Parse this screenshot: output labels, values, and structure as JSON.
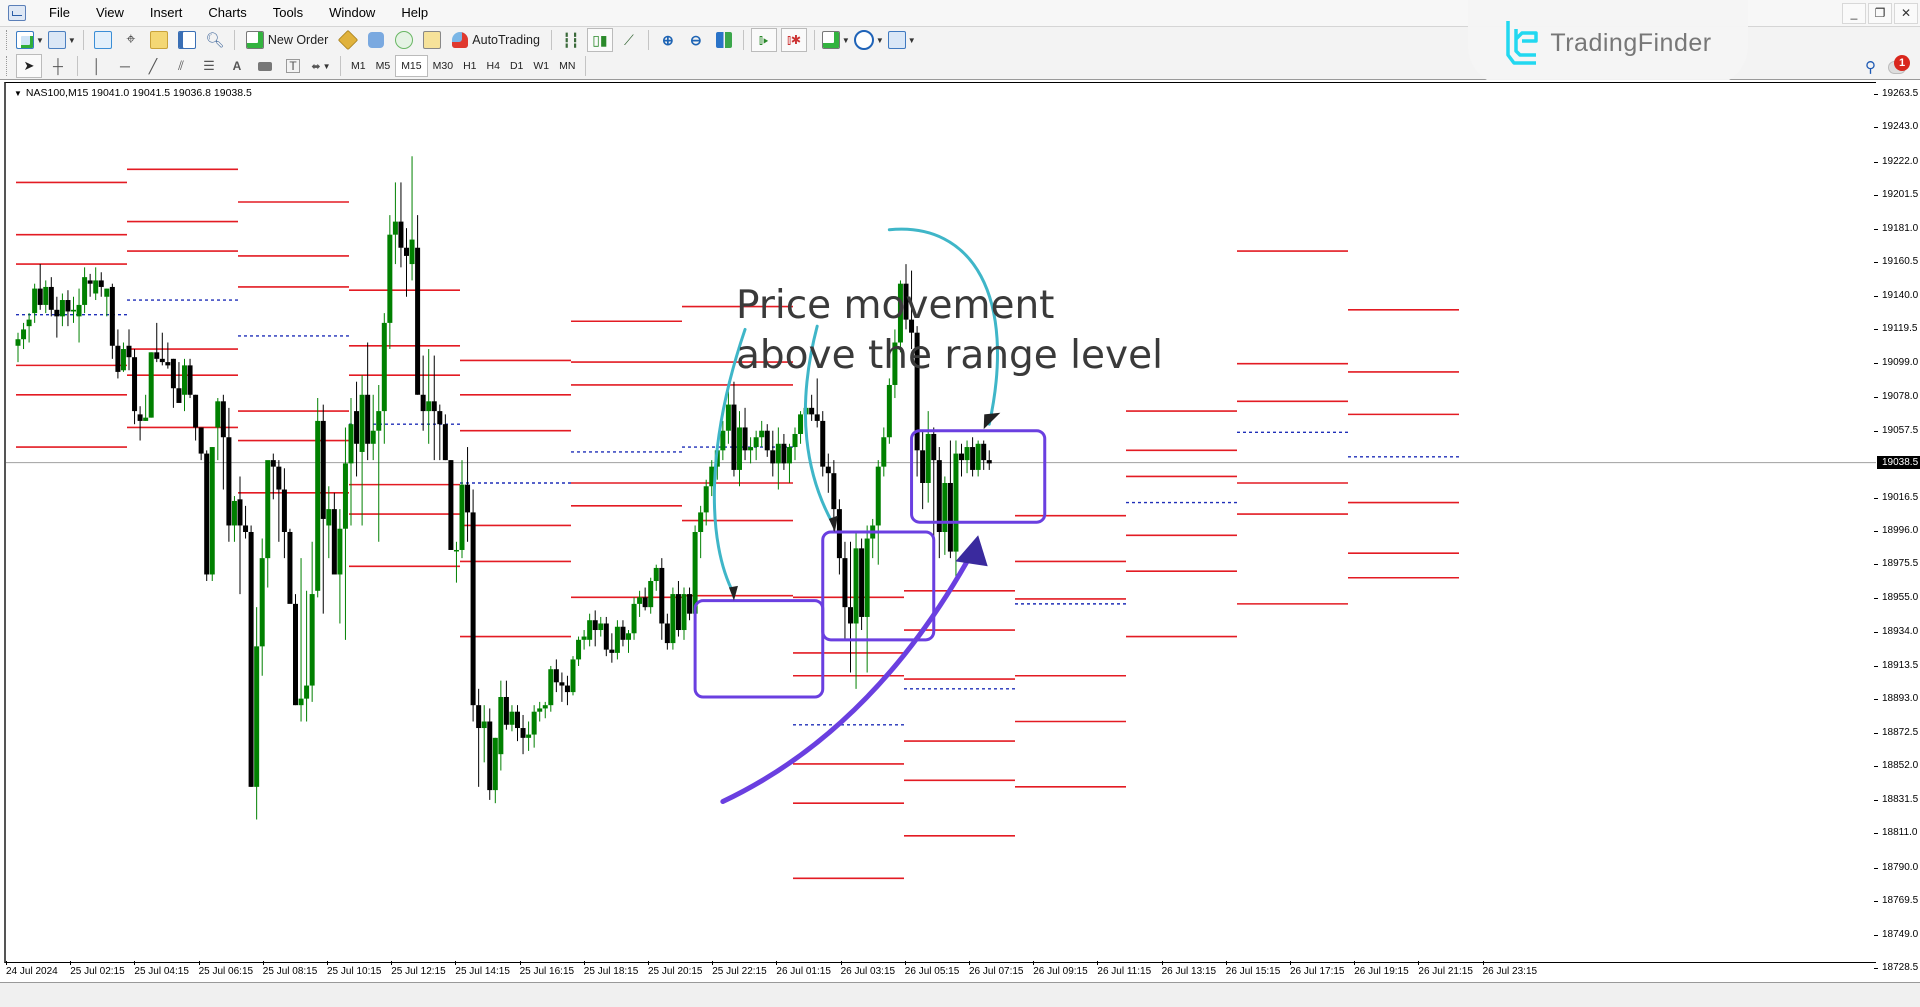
{
  "menubar": {
    "items": [
      "File",
      "View",
      "Insert",
      "Charts",
      "Tools",
      "Window",
      "Help"
    ]
  },
  "window_controls": {
    "minimize": "_",
    "restore": "❐",
    "close": "✕"
  },
  "toolbar": {
    "new_order_label": "New Order",
    "autotrading_label": "AutoTrading",
    "timeframes": [
      "M1",
      "M5",
      "M15",
      "M30",
      "H1",
      "H4",
      "D1",
      "W1",
      "MN"
    ],
    "active_timeframe": "M15",
    "drawing_tools": [
      "cursor",
      "crosshair",
      "vertical-line",
      "horizontal-line",
      "trendline",
      "equidistant-channel",
      "fibonacci",
      "text",
      "label",
      "text-label",
      "arrows"
    ]
  },
  "notifications": {
    "count": "1"
  },
  "brand": {
    "name": "TradingFinder"
  },
  "chart": {
    "symbol_header": "NAS100,M15  19041.0 19041.5 19036.8 19038.5",
    "current_price": "19038.5",
    "annotation": {
      "line1": "Price movement",
      "line2": "above the range level"
    }
  },
  "chart_data": {
    "type": "candlestick",
    "title": "NAS100,M15",
    "ohlc_header": {
      "open": 19041.0,
      "high": 19041.5,
      "low": 19036.8,
      "close": 19038.5
    },
    "ylim": [
      18728.5,
      19263.5
    ],
    "y_ticks": [
      "19263.5",
      "19243.0",
      "19222.0",
      "19201.5",
      "19181.0",
      "19160.5",
      "19140.0",
      "19119.5",
      "19099.0",
      "19078.0",
      "19057.5",
      "19038.5",
      "19016.5",
      "18996.0",
      "18975.5",
      "18955.0",
      "18934.0",
      "18913.5",
      "18893.0",
      "18872.5",
      "18852.0",
      "18831.5",
      "18811.0",
      "18790.0",
      "18769.5",
      "18749.0",
      "18728.5"
    ],
    "x_ticks": [
      "24 Jul 2024",
      "25 Jul 02:15",
      "25 Jul 04:15",
      "25 Jul 06:15",
      "25 Jul 08:15",
      "25 Jul 10:15",
      "25 Jul 12:15",
      "25 Jul 14:15",
      "25 Jul 16:15",
      "25 Jul 18:15",
      "25 Jul 20:15",
      "25 Jul 22:15",
      "26 Jul 01:15",
      "26 Jul 03:15",
      "26 Jul 05:15",
      "26 Jul 07:15",
      "26 Jul 09:15",
      "26 Jul 11:15",
      "26 Jul 13:15",
      "26 Jul 15:15",
      "26 Jul 17:15",
      "26 Jul 19:15",
      "26 Jul 21:15",
      "26 Jul 23:15"
    ],
    "bull_color": "#008000",
    "bear_color": "#000000",
    "level_color": "#e31b23",
    "mid_level_color": "#1f2fb8",
    "current_price_line": 19038.5,
    "candles": [
      [
        19110,
        19118,
        19100,
        19114
      ],
      [
        19114,
        19124,
        19108,
        19120
      ],
      [
        19122,
        19130,
        19112,
        19126
      ],
      [
        19130,
        19148,
        19124,
        19145
      ],
      [
        19145,
        19160,
        19132,
        19135
      ],
      [
        19135,
        19150,
        19130,
        19146
      ],
      [
        19146,
        19152,
        19128,
        19132
      ],
      [
        19132,
        19140,
        19115,
        19128
      ],
      [
        19128,
        19142,
        19122,
        19138
      ],
      [
        19138,
        19144,
        19122,
        19131
      ],
      [
        19131,
        19140,
        19124,
        19132
      ],
      [
        19128,
        19145,
        19112,
        19135
      ],
      [
        19135,
        19158,
        19130,
        19152
      ],
      [
        19150,
        19154,
        19140,
        19148
      ],
      [
        19142,
        19158,
        19138,
        19150
      ],
      [
        19150,
        19155,
        19140,
        19146
      ],
      [
        19140,
        19145,
        19128,
        19145
      ],
      [
        19146,
        19148,
        19102,
        19110
      ],
      [
        19110,
        19120,
        19090,
        19094
      ],
      [
        19095,
        19112,
        19094,
        19108
      ],
      [
        19110,
        19120,
        19095,
        19103
      ],
      [
        19103,
        19108,
        19062,
        19070
      ],
      [
        19068,
        19073,
        19052,
        19064
      ],
      [
        19064,
        19080,
        19064,
        19066
      ],
      [
        19066,
        19106,
        19066,
        19106
      ],
      [
        19106,
        19124,
        19100,
        19102
      ],
      [
        19102,
        19118,
        19098,
        19100
      ],
      [
        19100,
        19112,
        19096,
        19098
      ],
      [
        19102,
        19102,
        19072,
        19084
      ],
      [
        19084,
        19100,
        19076,
        19075
      ],
      [
        19080,
        19102,
        19070,
        19098
      ],
      [
        19098,
        19102,
        19078,
        19080
      ],
      [
        19080,
        19080,
        19052,
        19060
      ],
      [
        19060,
        19060,
        19040,
        19044
      ],
      [
        19044,
        19046,
        18966,
        18970
      ],
      [
        18970,
        19048,
        18966,
        19048
      ],
      [
        19060,
        19078,
        19040,
        19076
      ],
      [
        19076,
        19080,
        19022,
        19054
      ],
      [
        19054,
        19072,
        18990,
        19000
      ],
      [
        19000,
        19018,
        18990,
        19015
      ],
      [
        19016,
        19030,
        18958,
        19000
      ],
      [
        19000,
        19012,
        18992,
        18996
      ],
      [
        18996,
        19000,
        18840,
        18840
      ],
      [
        18840,
        18950,
        18820,
        18926
      ],
      [
        18926,
        18992,
        18908,
        18980
      ],
      [
        18980,
        19020,
        18962,
        19040
      ],
      [
        19040,
        19044,
        19016,
        19036
      ],
      [
        19036,
        19040,
        18990,
        19022
      ],
      [
        19022,
        19035,
        18980,
        18996
      ],
      [
        18996,
        18998,
        18956,
        18952
      ],
      [
        18952,
        18958,
        18890,
        18890
      ],
      [
        18890,
        18980,
        18880,
        18894
      ],
      [
        18894,
        18960,
        18880,
        18902
      ],
      [
        18902,
        18990,
        18892,
        18958
      ],
      [
        18960,
        19078,
        18956,
        19064
      ],
      [
        19064,
        19074,
        18946,
        19004
      ],
      [
        19000,
        19024,
        18980,
        19010
      ],
      [
        19010,
        19020,
        18980,
        18970
      ],
      [
        18970,
        19010,
        18940,
        18998
      ],
      [
        18998,
        19060,
        18930,
        19038
      ],
      [
        19038,
        19078,
        19000,
        19062
      ],
      [
        19070,
        19088,
        19030,
        19050
      ],
      [
        19045,
        19092,
        19000,
        19080
      ],
      [
        19080,
        19112,
        19040,
        19050
      ],
      [
        19050,
        19080,
        19040,
        19058
      ],
      [
        19058,
        19086,
        18990,
        19070
      ],
      [
        19070,
        19130,
        19050,
        19124
      ],
      [
        19124,
        19190,
        19108,
        19178
      ],
      [
        19178,
        19210,
        19160,
        19186
      ],
      [
        19186,
        19210,
        19158,
        19170
      ],
      [
        19170,
        19182,
        19140,
        19165
      ],
      [
        19160,
        19226,
        19150,
        19175
      ],
      [
        19170,
        19190,
        19080,
        19080
      ],
      [
        19080,
        19104,
        19058,
        19070
      ],
      [
        19070,
        19108,
        19050,
        19076
      ],
      [
        19076,
        19104,
        19040,
        19070
      ],
      [
        19070,
        19074,
        19040,
        19062
      ],
      [
        19062,
        19068,
        19040,
        19040
      ],
      [
        19040,
        19040,
        19016,
        18985
      ],
      [
        18985,
        18990,
        18965,
        18985
      ],
      [
        18985,
        19040,
        18980,
        19025
      ],
      [
        19025,
        19048,
        18990,
        19008
      ],
      [
        19008,
        19022,
        18880,
        18890
      ],
      [
        18890,
        18900,
        18840,
        18876
      ],
      [
        18876,
        18890,
        18855,
        18880
      ],
      [
        18880,
        18888,
        18832,
        18838
      ],
      [
        18838,
        18870,
        18830,
        18870
      ],
      [
        18860,
        18905,
        18850,
        18895
      ],
      [
        18895,
        18905,
        18875,
        18878
      ],
      [
        18878,
        18890,
        18874,
        18886
      ],
      [
        18886,
        18890,
        18868,
        18876
      ],
      [
        18876,
        18884,
        18860,
        18870
      ],
      [
        18870,
        18880,
        18862,
        18872
      ],
      [
        18872,
        18890,
        18864,
        18886
      ],
      [
        18886,
        18892,
        18880,
        18888
      ],
      [
        18888,
        18892,
        18882,
        18890
      ],
      [
        18890,
        18914,
        18886,
        18912
      ],
      [
        18912,
        18918,
        18898,
        18904
      ],
      [
        18904,
        18910,
        18892,
        18902
      ],
      [
        18902,
        18908,
        18890,
        18898
      ],
      [
        18898,
        18920,
        18896,
        18918
      ],
      [
        18918,
        18932,
        18914,
        18930
      ],
      [
        18930,
        18936,
        18924,
        18932
      ],
      [
        18930,
        18946,
        18926,
        18942
      ],
      [
        18942,
        18948,
        18926,
        18936
      ],
      [
        18936,
        18944,
        18932,
        18940
      ],
      [
        18940,
        18944,
        18920,
        18924
      ],
      [
        18924,
        18934,
        18916,
        18922
      ],
      [
        18922,
        18942,
        18918,
        18938
      ],
      [
        18938,
        18942,
        18926,
        18930
      ],
      [
        18930,
        18936,
        18922,
        18934
      ],
      [
        18934,
        18956,
        18930,
        18952
      ],
      [
        18952,
        18960,
        18944,
        18956
      ],
      [
        18956,
        18962,
        18948,
        18950
      ],
      [
        18950,
        18968,
        18946,
        18966
      ],
      [
        18966,
        18976,
        18960,
        18974
      ],
      [
        18974,
        18980,
        18930,
        18940
      ],
      [
        18940,
        18946,
        18924,
        18928
      ],
      [
        18928,
        18962,
        18924,
        18958
      ],
      [
        18958,
        18966,
        18932,
        18936
      ],
      [
        18936,
        18962,
        18930,
        18958
      ],
      [
        18958,
        18962,
        18942,
        18946
      ],
      [
        18946,
        19000,
        18944,
        18996
      ],
      [
        18996,
        19012,
        18980,
        19008
      ],
      [
        19008,
        19028,
        19000,
        19024
      ],
      [
        19024,
        19040,
        19018,
        19036
      ],
      [
        19036,
        19050,
        19028,
        19046
      ],
      [
        19046,
        19064,
        19040,
        19058
      ],
      [
        19058,
        19082,
        19050,
        19074
      ],
      [
        19074,
        19088,
        19030,
        19034
      ],
      [
        19034,
        19070,
        19024,
        19060
      ],
      [
        19060,
        19072,
        19040,
        19046
      ],
      [
        19046,
        19054,
        19038,
        19048
      ],
      [
        19048,
        19058,
        19040,
        19054
      ],
      [
        19054,
        19064,
        19048,
        19058
      ],
      [
        19058,
        19062,
        19042,
        19046
      ],
      [
        19046,
        19058,
        19030,
        19038
      ],
      [
        19038,
        19060,
        19022,
        19050
      ],
      [
        19050,
        19056,
        19034,
        19038
      ],
      [
        19038,
        19050,
        19026,
        19048
      ],
      [
        19048,
        19060,
        19040,
        19056
      ],
      [
        19056,
        19070,
        19050,
        19068
      ],
      [
        19068,
        19076,
        19062,
        19072
      ],
      [
        19072,
        19080,
        19064,
        19068
      ],
      [
        19068,
        19090,
        19060,
        19064
      ],
      [
        19064,
        19070,
        19030,
        19036
      ],
      [
        19036,
        19044,
        19020,
        19032
      ],
      [
        19032,
        19040,
        18996,
        19010
      ],
      [
        19010,
        19016,
        18970,
        18980
      ],
      [
        18980,
        18990,
        18930,
        18950
      ],
      [
        18950,
        18990,
        18910,
        18940
      ],
      [
        18940,
        18996,
        18900,
        18986
      ],
      [
        18986,
        18992,
        18936,
        18944
      ],
      [
        18944,
        19000,
        18910,
        18992
      ],
      [
        18992,
        19004,
        18980,
        19000
      ],
      [
        19000,
        19040,
        18976,
        19036
      ],
      [
        19036,
        19060,
        19030,
        19054
      ],
      [
        19054,
        19090,
        19050,
        19086
      ],
      [
        19086,
        19120,
        19078,
        19112
      ],
      [
        19112,
        19150,
        19106,
        19148
      ],
      [
        19148,
        19160,
        19120,
        19126
      ],
      [
        19126,
        19156,
        19108,
        19118
      ],
      [
        19118,
        19122,
        19030,
        19046
      ],
      [
        19046,
        19058,
        19010,
        19026
      ],
      [
        19026,
        19070,
        19014,
        19056
      ],
      [
        19056,
        19060,
        18990,
        19040
      ],
      [
        19040,
        19048,
        18980,
        18996
      ],
      [
        18996,
        19030,
        18982,
        19026
      ],
      [
        19026,
        19052,
        18980,
        18984
      ],
      [
        18984,
        19052,
        18968,
        19044
      ],
      [
        19044,
        19050,
        19030,
        19040
      ],
      [
        19040,
        19052,
        19032,
        19048
      ],
      [
        19048,
        19054,
        19030,
        19034
      ],
      [
        19034,
        19052,
        19030,
        19050
      ],
      [
        19050,
        19052,
        19034,
        19040
      ],
      [
        19040,
        19046,
        19034,
        19038
      ]
    ],
    "range_levels": [
      {
        "from": 0,
        "to": 20,
        "levels": [
          19210,
          19178,
          19160,
          19098,
          19080,
          19048
        ],
        "mid": 19129
      },
      {
        "from": 20,
        "to": 40,
        "levels": [
          19218,
          19186,
          19168,
          19108,
          19092,
          19060
        ],
        "mid": 19138
      },
      {
        "from": 40,
        "to": 60,
        "levels": [
          19198,
          19165,
          19146,
          19070,
          19052,
          19020
        ],
        "mid": 19116
      },
      {
        "from": 60,
        "to": 80,
        "levels": [
          19144,
          19110,
          19092,
          19025,
          19007,
          18975
        ],
        "mid": 19062
      },
      {
        "from": 80,
        "to": 100,
        "levels": [
          19101,
          19080,
          19058,
          19000,
          18978,
          18932
        ],
        "mid": 19026
      },
      {
        "from": 100,
        "to": 120,
        "levels": [
          19125,
          19100,
          19086,
          19026,
          19012,
          18956
        ],
        "mid": 19045
      },
      {
        "from": 120,
        "to": 140,
        "levels": [
          19134,
          19100,
          19086,
          19026,
          19003,
          18957
        ],
        "mid": 19048
      },
      {
        "from": 140,
        "to": 160,
        "levels": [
          18956,
          18922,
          18908,
          18854,
          18830,
          18784
        ],
        "mid": 18878
      },
      {
        "from": 160,
        "to": 180,
        "levels": [
          18960,
          18936,
          18906,
          18868,
          18844,
          18810
        ],
        "mid": 18900
      },
      {
        "from": 180,
        "to": 200,
        "levels": [
          19006,
          18978,
          18955,
          18908,
          18880,
          18840
        ],
        "mid": 18952
      },
      {
        "from": 200,
        "to": 220,
        "levels": [
          19070,
          19046,
          19030,
          18994,
          18972,
          18932
        ],
        "mid": 19014
      },
      {
        "from": 220,
        "to": 240,
        "levels": [
          19168,
          19099,
          19076,
          19026,
          19007,
          18952
        ],
        "mid": 19057
      },
      {
        "from": 240,
        "to": 260,
        "levels": [
          19132,
          19094,
          19068,
          19014,
          18983,
          18968
        ],
        "mid": 19042
      }
    ]
  }
}
